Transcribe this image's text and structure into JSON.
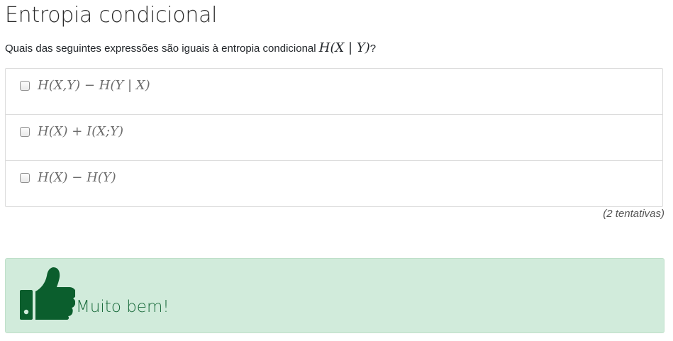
{
  "title": "Entropia condicional",
  "question": {
    "text": "Quais das seguintes expressões são iguais à entropia condicional",
    "math": "H(X | Y)",
    "suffix": "?"
  },
  "options": [
    {
      "label": "H(X,Y) − H(Y | X)",
      "checked": false
    },
    {
      "label": "H(X) + I(X;Y)",
      "checked": false
    },
    {
      "label": "H(X) − H(Y)",
      "checked": false
    }
  ],
  "attempts": "(2 tentativas)",
  "feedback": {
    "icon": "thumbs-up-icon",
    "text": "Muito bem!",
    "color": "#0b5e2d",
    "background": "#d1ebdb"
  }
}
